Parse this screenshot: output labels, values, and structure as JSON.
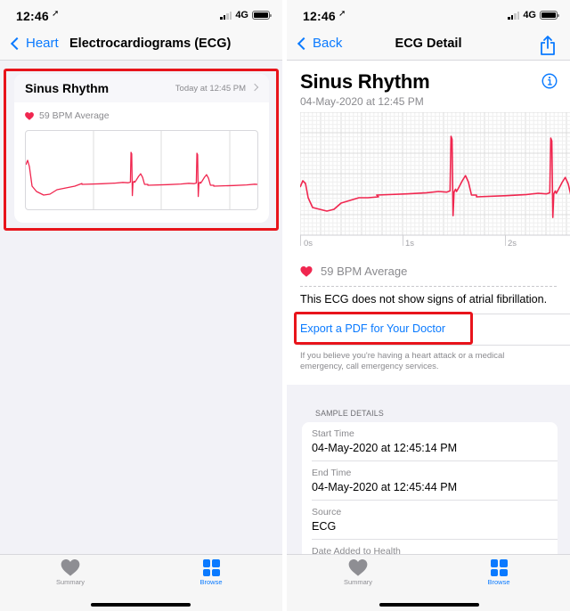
{
  "status_bar": {
    "time": "12:46",
    "network": "4G",
    "location_icon": "location-arrow-icon"
  },
  "left_screen": {
    "nav": {
      "back_label": "Heart",
      "title": "Electrocardiograms (ECG)"
    },
    "card": {
      "title": "Sinus Rhythm",
      "date": "Today at 12:45 PM",
      "bpm_text": "59 BPM Average",
      "highlighted": true
    },
    "tabs": [
      {
        "label": "Summary",
        "icon": "heart-icon",
        "active": false
      },
      {
        "label": "Browse",
        "icon": "grid-icon",
        "active": true
      }
    ]
  },
  "right_screen": {
    "nav": {
      "back_label": "Back",
      "title": "ECG Detail",
      "action_icon": "share-icon"
    },
    "title": "Sinus Rhythm",
    "date": "04-May-2020 at 12:45 PM",
    "chart_time_labels": [
      "0s",
      "1s",
      "2s"
    ],
    "bpm_text": "59 BPM Average",
    "classification_text": "This ECG does not show signs of atrial fibrillation.",
    "export_link": "Export a PDF for Your Doctor",
    "export_highlighted": true,
    "disclaimer": "If you believe you're having a heart attack or a medical emergency, call emergency services.",
    "sample_details": {
      "header": "SAMPLE DETAILS",
      "rows": [
        {
          "key": "Start Time",
          "value": "04-May-2020 at 12:45:14 PM"
        },
        {
          "key": "End Time",
          "value": "04-May-2020 at 12:45:44 PM"
        },
        {
          "key": "Source",
          "value": "ECG"
        },
        {
          "key": "Date Added to Health",
          "value": ""
        }
      ]
    },
    "tabs": [
      {
        "label": "Summary",
        "icon": "heart-icon",
        "active": false
      },
      {
        "label": "Browse",
        "icon": "grid-icon",
        "active": true
      }
    ]
  },
  "colors": {
    "accent": "#0a7aff",
    "ecg_trace": "#f0264f",
    "highlight": "#e8141b",
    "heart": "#f0264f"
  }
}
